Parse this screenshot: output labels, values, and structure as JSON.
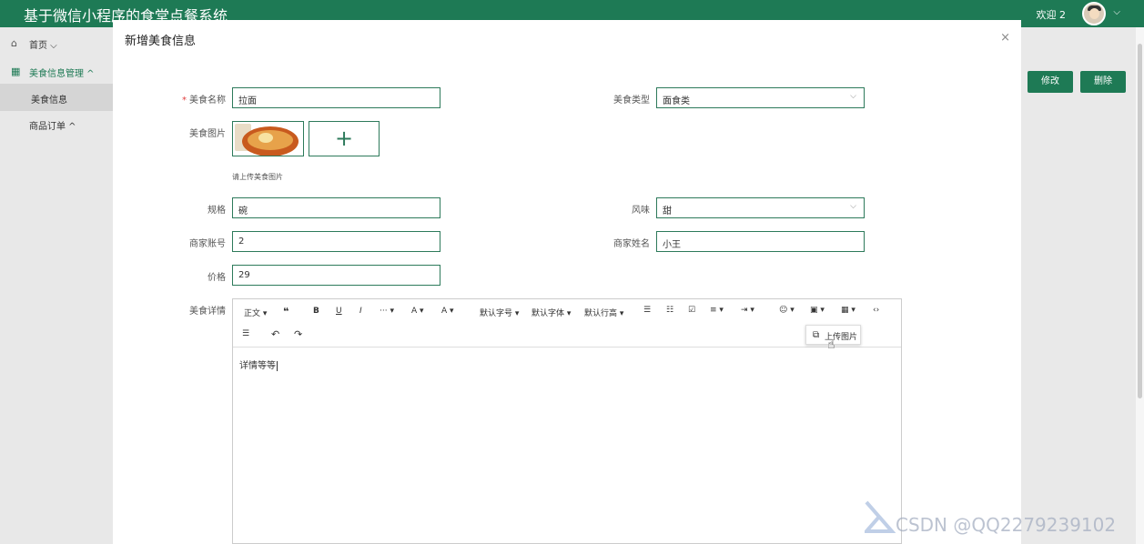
{
  "app": {
    "title": "基于微信小程序的食堂点餐系统",
    "welcome": "欢迎 2"
  },
  "sidebar": {
    "home": "首页",
    "food_mgmt": "美食信息管理",
    "food_info": "美食信息",
    "orders": "商品订单"
  },
  "background": {
    "edit_label": "修改",
    "delete_label": "删除"
  },
  "modal": {
    "title": "新增美食信息",
    "close": "×"
  },
  "form": {
    "name_label": "美食名称",
    "name_value": "拉面",
    "type_label": "美食类型",
    "type_value": "面食类",
    "image_label": "美食图片",
    "image_hint": "请上传美食图片",
    "spec_label": "规格",
    "spec_value": "碗",
    "flavor_label": "风味",
    "flavor_value": "甜",
    "merchant_account_label": "商家账号",
    "merchant_account_value": "2",
    "merchant_name_label": "商家姓名",
    "merchant_name_value": "小王",
    "price_label": "价格",
    "price_value": "29",
    "detail_label": "美食详情",
    "detail_value": "详情等等"
  },
  "editor_toolbar": {
    "paragraph": "正文",
    "quote": "❝",
    "bold": "B",
    "underline": "U",
    "italic": "I",
    "more": "···",
    "font_color": "A",
    "bg_color": "A",
    "font_size": "默认字号",
    "font_family": "默认字体",
    "line_height": "默认行高",
    "upload_image": "上传图片"
  },
  "watermark": "CSDN @QQ2279239102"
}
